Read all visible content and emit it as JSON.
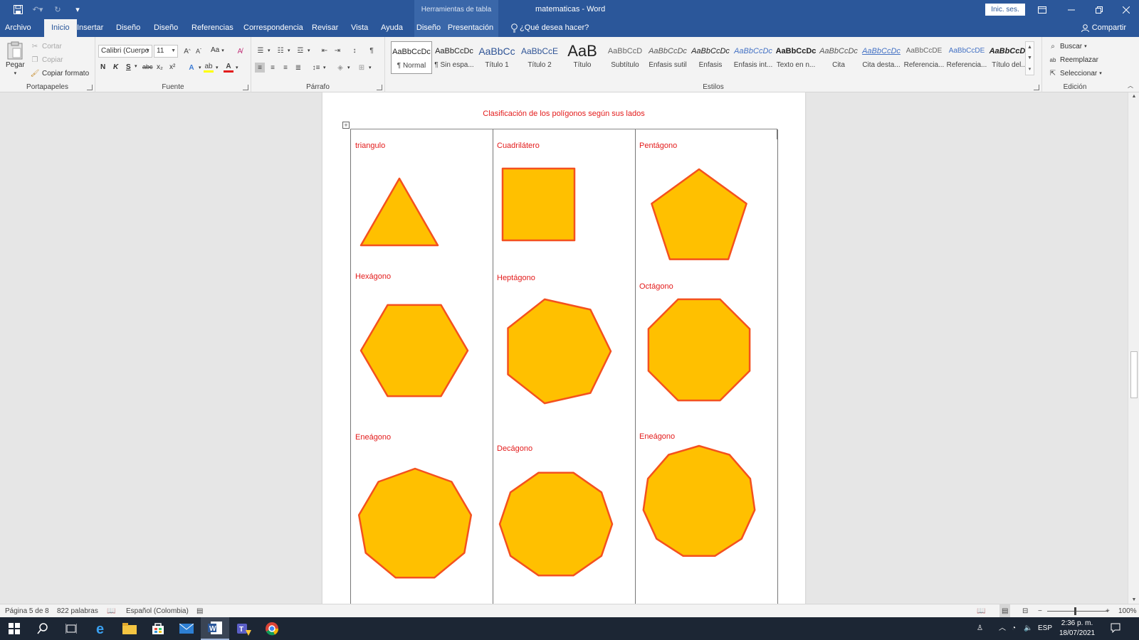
{
  "app": {
    "doc_title": "matematicas  -  Word",
    "context_tab_group": "Herramientas de tabla",
    "signin": "Inic. ses.",
    "share": "Compartir"
  },
  "tabs": [
    "Archivo",
    "Inicio",
    "Insertar",
    "Diseño",
    "Diseño",
    "Referencias",
    "Correspondencia",
    "Revisar",
    "Vista",
    "Ayuda",
    "Diseño",
    "Presentación"
  ],
  "tell_me": "¿Qué desea hacer?",
  "ribbon": {
    "clipboard": {
      "paste": "Pegar",
      "cut": "Cortar",
      "copy": "Copiar",
      "format_painter": "Copiar formato",
      "label": "Portapapeles"
    },
    "font": {
      "name": "Calibri (Cuerpo",
      "size": "11",
      "case": "Aa",
      "bold": "N",
      "italic": "K",
      "underline": "S",
      "strike": "abc",
      "sub": "x₂",
      "sup": "x²",
      "label": "Fuente"
    },
    "paragraph": {
      "label": "Párrafo"
    },
    "styles": {
      "label": "Estilos",
      "items": [
        {
          "preview": "AaBbCcDc",
          "name": "¶ Normal"
        },
        {
          "preview": "AaBbCcDc",
          "name": "¶ Sin espa..."
        },
        {
          "preview": "AaBbCc",
          "name": "Título 1"
        },
        {
          "preview": "AaBbCcE",
          "name": "Título 2"
        },
        {
          "preview": "AaB",
          "name": "Título"
        },
        {
          "preview": "AaBbCcD",
          "name": "Subtítulo"
        },
        {
          "preview": "AaBbCcDc",
          "name": "Énfasis sutil"
        },
        {
          "preview": "AaBbCcDc",
          "name": "Énfasis"
        },
        {
          "preview": "AaBbCcDc",
          "name": "Énfasis int..."
        },
        {
          "preview": "AaBbCcDc",
          "name": "Texto en n..."
        },
        {
          "preview": "AaBbCcDc",
          "name": "Cita"
        },
        {
          "preview": "AaBbCcDc",
          "name": "Cita desta..."
        },
        {
          "preview": "AaBbCcDE",
          "name": "Referencia..."
        },
        {
          "preview": "AaBbCcDE",
          "name": "Referencia..."
        },
        {
          "preview": "AaBbCcDc",
          "name": "Título del..."
        }
      ]
    },
    "editing": {
      "find": "Buscar",
      "replace": "Reemplazar",
      "select": "Seleccionar",
      "label": "Edición"
    }
  },
  "document": {
    "heading": "Clasificación de los polígonos según sus lados",
    "cells": [
      {
        "label": "triangulo",
        "sides": 3
      },
      {
        "label": "Cuadrilátero",
        "sides": 4
      },
      {
        "label": "Pentágono",
        "sides": 5
      },
      {
        "label": "Hexágono",
        "sides": 6
      },
      {
        "label": "Heptágono",
        "sides": 7
      },
      {
        "label": "Octágono",
        "sides": 8
      },
      {
        "label": "Eneágono",
        "sides": 9
      },
      {
        "label": "Decágono",
        "sides": 10
      },
      {
        "label": "Eneágono",
        "sides": 11
      }
    ],
    "shape_fill": "#ffc000",
    "shape_stroke": "#f4511e"
  },
  "status": {
    "page": "Página 5 de 8",
    "words": "822 palabras",
    "language": "Español (Colombia)",
    "zoom": "100%"
  },
  "taskbar": {
    "lang": "ESP",
    "time": "2:36 p. m.",
    "date": "18/07/2021"
  },
  "colors": {
    "word_blue": "#2b579a",
    "red_text": "#e31b1b"
  }
}
